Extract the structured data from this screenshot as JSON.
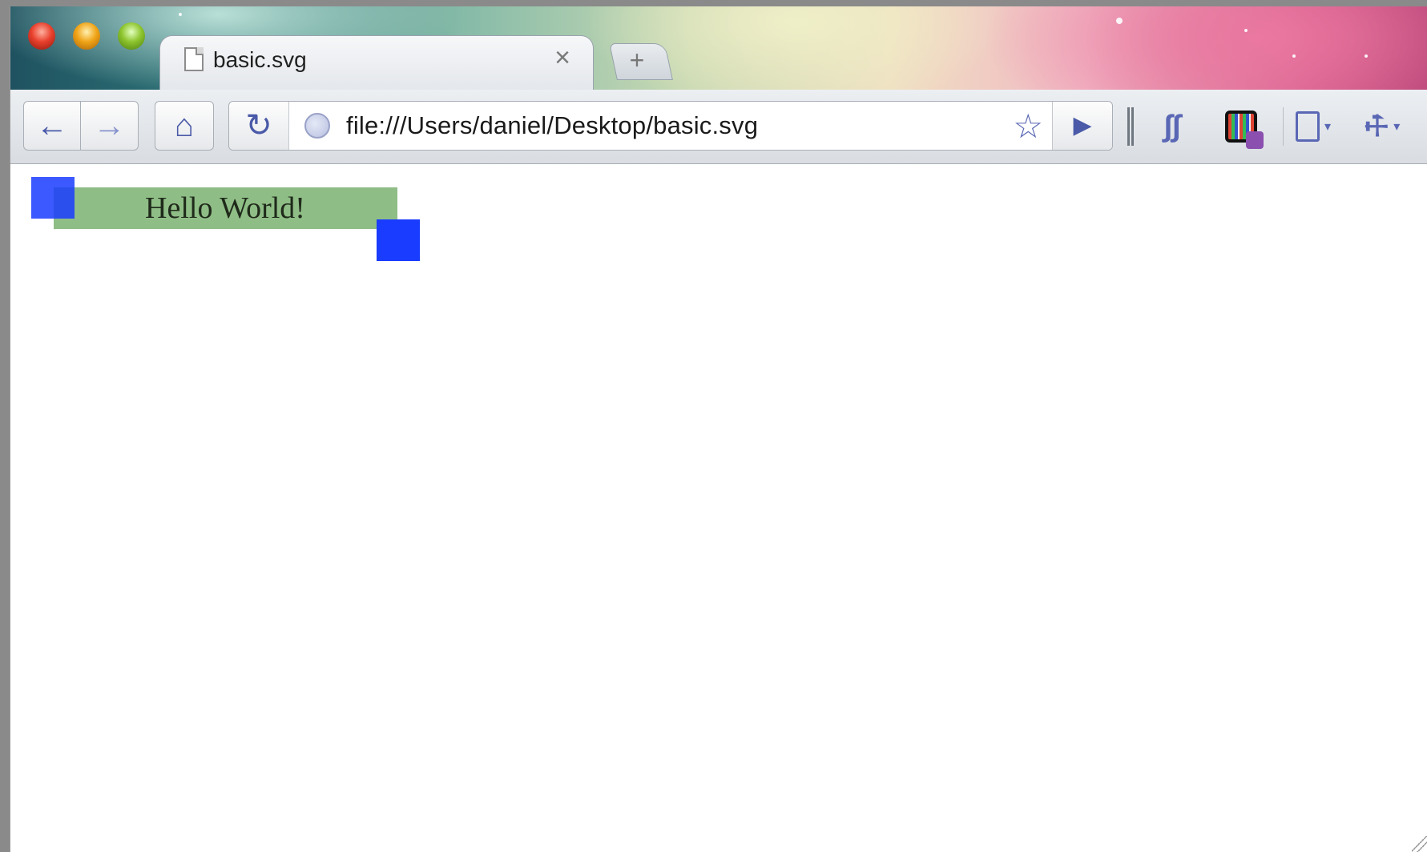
{
  "window": {
    "controls": [
      "close-button",
      "minimize-button",
      "zoom-button"
    ]
  },
  "tab": {
    "title": "basic.svg",
    "close_glyph": "×",
    "new_tab_glyph": "+"
  },
  "toolbar": {
    "back_glyph": "←",
    "forward_glyph": "→",
    "home_glyph": "⌂",
    "reload_glyph": "↻",
    "url": "file:///Users/daniel/Desktop/basic.svg",
    "star_glyph": "☆",
    "go_glyph": "▶",
    "ext_a_glyph": "∫∫",
    "caret_glyph": "▾",
    "wrench_glyph": "🔧"
  },
  "page": {
    "svg_text": "Hello World!",
    "colors": {
      "rect_fill": "#8fbd86",
      "handle_fill": "#1a3cff",
      "text": "#1f2a1a"
    }
  }
}
